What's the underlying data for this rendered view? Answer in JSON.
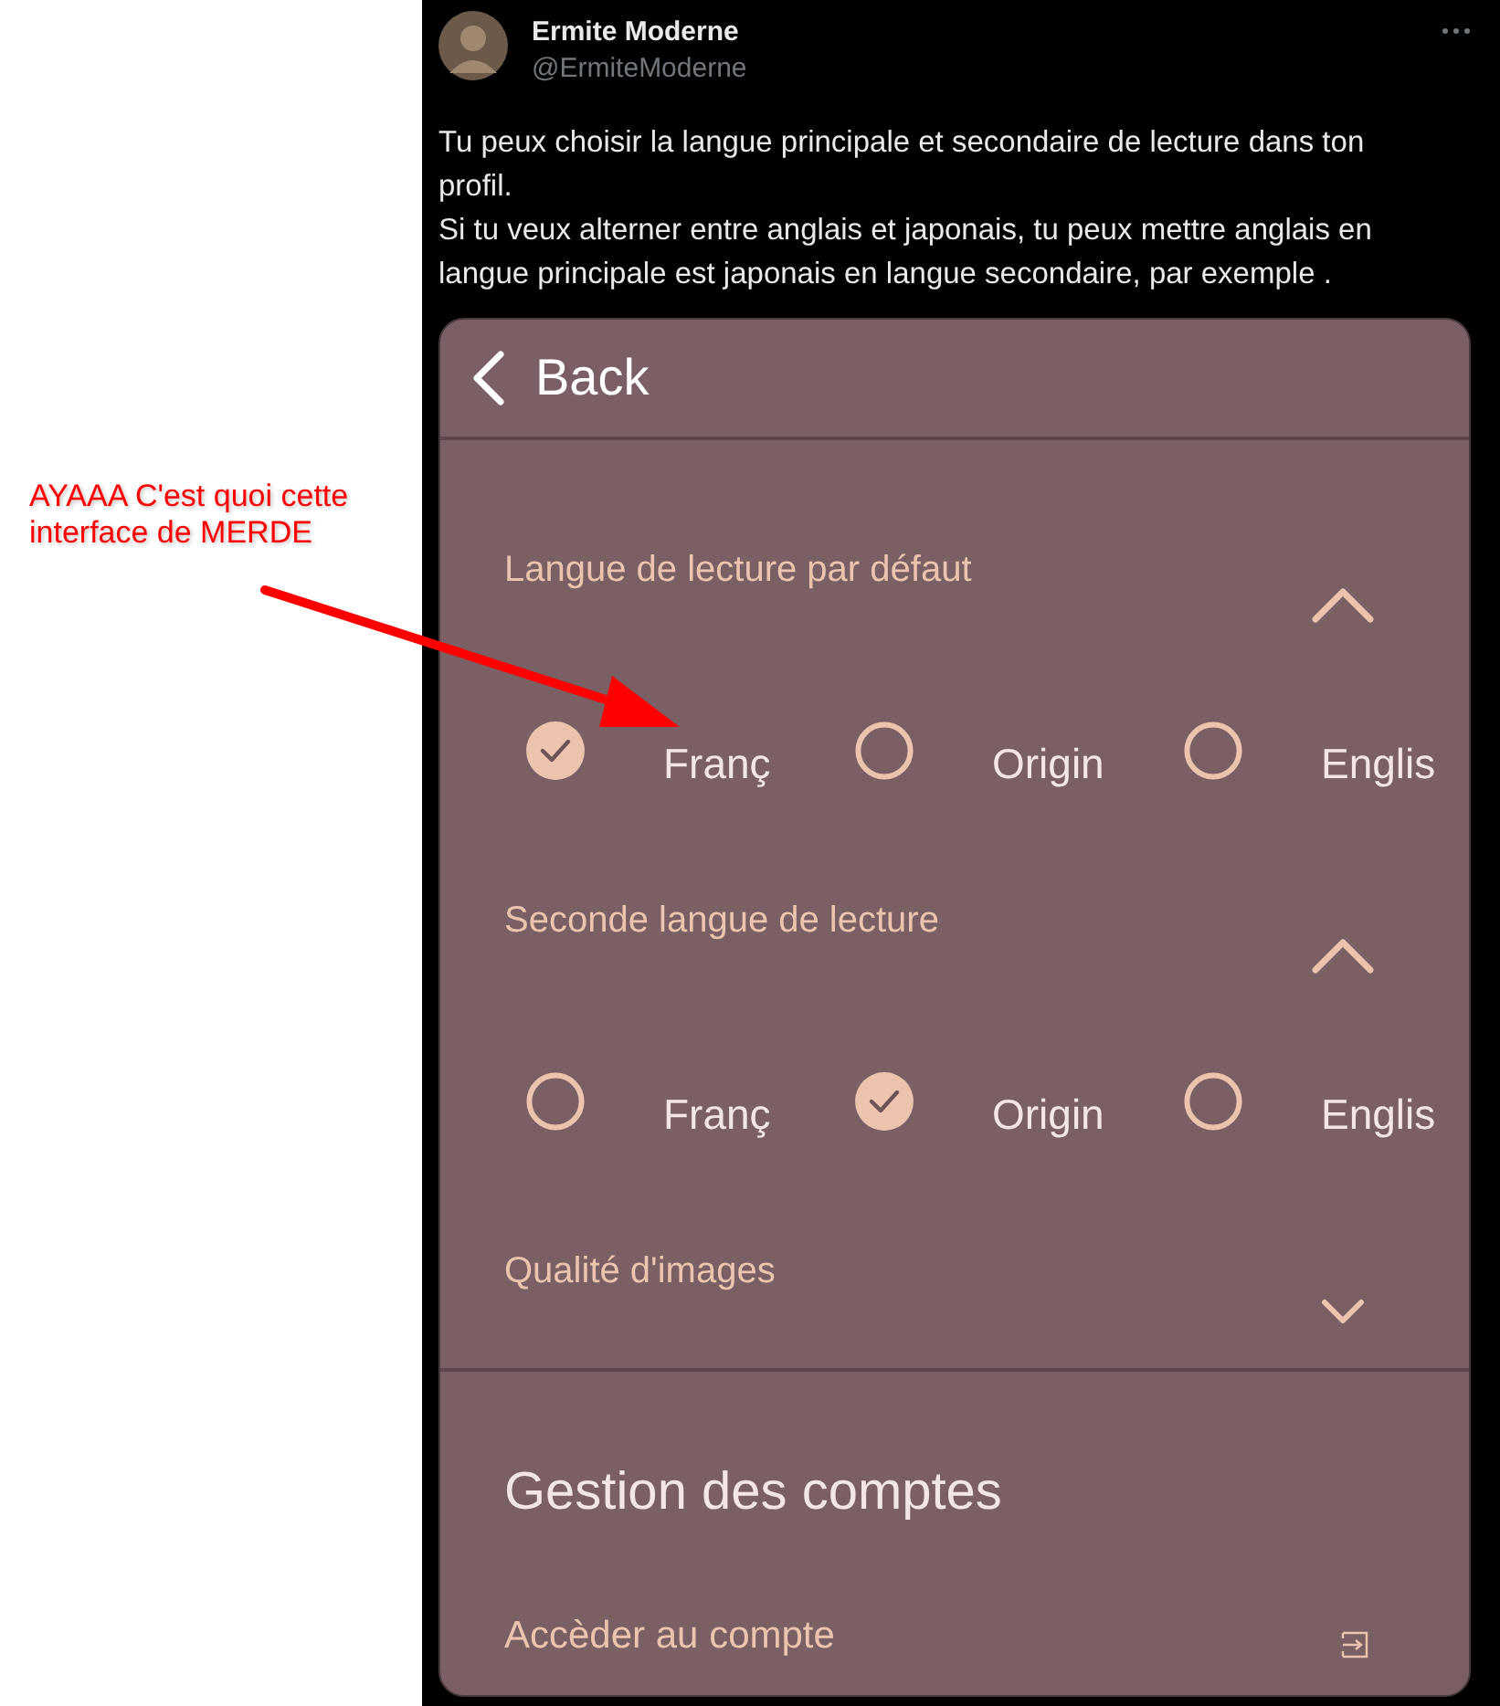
{
  "annotation": {
    "text": "AYAAA C'est quoi cette interface de MERDE"
  },
  "tweet": {
    "author": {
      "name": "Ermite Moderne",
      "handle": "@ErmiteModerne"
    },
    "paragraphs": [
      "Tu peux choisir la langue principale et secondaire de lecture dans ton profil.",
      "Si tu veux alterner entre anglais et japonais, tu peux mettre anglais en langue principale est japonais en langue secondaire, par exemple ."
    ]
  },
  "app": {
    "back": "Back",
    "sections": [
      {
        "title": "Langue de lecture par défaut",
        "expanded": true,
        "options": [
          {
            "label": "Franç",
            "selected": true
          },
          {
            "label": "Origin",
            "selected": false
          },
          {
            "label": "Englis",
            "selected": false
          }
        ]
      },
      {
        "title": "Seconde langue de lecture",
        "expanded": true,
        "options": [
          {
            "label": "Franç",
            "selected": false
          },
          {
            "label": "Origin",
            "selected": true
          },
          {
            "label": "Englis",
            "selected": false
          }
        ]
      },
      {
        "title": "Qualité d'images",
        "expanded": false
      }
    ],
    "account_heading": "Gestion des comptes",
    "account_item": "Accèder au compte"
  }
}
